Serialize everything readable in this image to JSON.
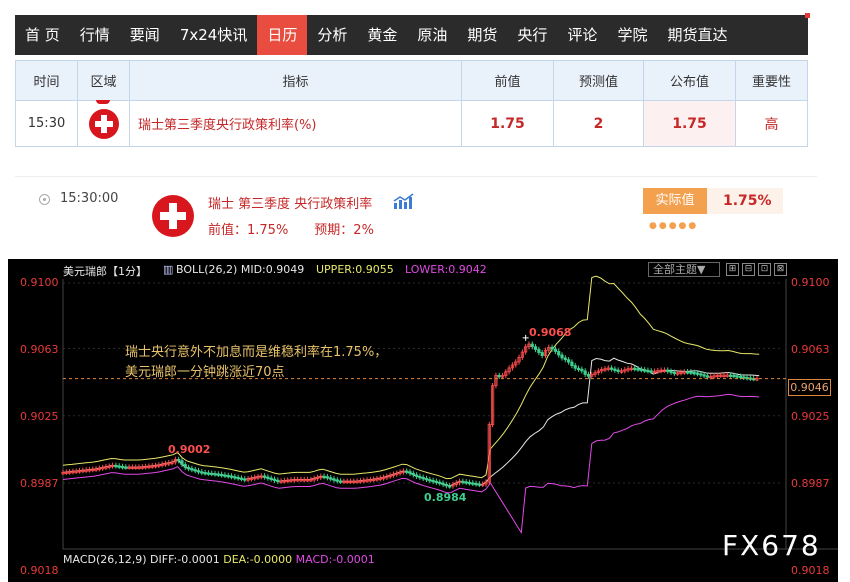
{
  "nav": {
    "items": [
      "首 页",
      "行情",
      "要闻",
      "7x24快讯",
      "日历",
      "分析",
      "黄金",
      "原油",
      "期货",
      "央行",
      "评论",
      "学院",
      "期货直达"
    ],
    "active_index": 4,
    "active_color": "#e94d3f"
  },
  "calendar": {
    "headers": {
      "time": "时间",
      "region": "区域",
      "indicator": "指标",
      "previous": "前值",
      "forecast": "预测值",
      "actual": "公布值",
      "importance": "重要性"
    },
    "row": {
      "time": "15:30",
      "flag": "swiss-flag-icon",
      "indicator": "瑞士第三季度央行政策利率(%)",
      "previous": "1.75",
      "forecast": "2",
      "actual": "1.75",
      "importance": "高"
    }
  },
  "event": {
    "time": "15:30:00",
    "title": "瑞士 第三季度 央行政策利率",
    "sub": "前值：1.75%　　预期：2%",
    "actual_label": "实际值",
    "actual_value": "1.75%",
    "stars": "●●●●●"
  },
  "chart_header": {
    "symbol": "美元瑞郎【1分】",
    "boll": "BOLL(26,2) MID:0.9049",
    "upper": "UPPER:0.9055",
    "lower": "LOWER:0.9042",
    "theme": "全部主题▼",
    "tools": [
      "⊞",
      "⊟",
      "⊡",
      "⊠"
    ]
  },
  "chart_data": {
    "type": "candlestick",
    "yticks": [
      "0.9100",
      "0.9063",
      "0.9025",
      "0.8987",
      "0.9018"
    ],
    "ylim": [
      0.8968,
      0.9106
    ],
    "current_price": "0.9046",
    "labels": {
      "high1": "0.9002",
      "low1": "0.8984",
      "high2": "0.9068"
    },
    "annotation": [
      "瑞士央行意外不加息而是维稳利率在1.75%，",
      "美元瑞郎一分钟跳涨近70点"
    ],
    "close_path": [
      [
        0,
        0.8993
      ],
      [
        15,
        0.8994
      ],
      [
        30,
        0.8995
      ],
      [
        45,
        0.8997
      ],
      [
        55,
        0.8996
      ],
      [
        70,
        0.8996
      ],
      [
        85,
        0.8997
      ],
      [
        100,
        0.8999
      ],
      [
        103,
        0.9001
      ],
      [
        110,
        0.8996
      ],
      [
        125,
        0.8993
      ],
      [
        140,
        0.8992
      ],
      [
        150,
        0.8991
      ],
      [
        165,
        0.8989
      ],
      [
        180,
        0.8991
      ],
      [
        195,
        0.8988
      ],
      [
        210,
        0.8989
      ],
      [
        225,
        0.8989
      ],
      [
        235,
        0.8991
      ],
      [
        250,
        0.8988
      ],
      [
        265,
        0.8988
      ],
      [
        280,
        0.8989
      ],
      [
        290,
        0.899
      ],
      [
        300,
        0.8992
      ],
      [
        310,
        0.8994
      ],
      [
        320,
        0.8991
      ],
      [
        330,
        0.8989
      ],
      [
        342,
        0.8987
      ],
      [
        350,
        0.8985
      ],
      [
        360,
        0.8988
      ],
      [
        370,
        0.8987
      ],
      [
        380,
        0.8986
      ],
      [
        385,
        0.8988
      ],
      [
        388,
        0.9036
      ],
      [
        392,
        0.9048
      ],
      [
        398,
        0.9047
      ],
      [
        405,
        0.9052
      ],
      [
        412,
        0.9056
      ],
      [
        418,
        0.9062
      ],
      [
        422,
        0.9066
      ],
      [
        428,
        0.9063
      ],
      [
        435,
        0.9059
      ],
      [
        440,
        0.9064
      ],
      [
        446,
        0.9062
      ],
      [
        452,
        0.9058
      ],
      [
        458,
        0.9056
      ],
      [
        464,
        0.9052
      ],
      [
        470,
        0.9051
      ],
      [
        476,
        0.9047
      ],
      [
        482,
        0.9049
      ],
      [
        488,
        0.9051
      ],
      [
        495,
        0.9052
      ],
      [
        505,
        0.905
      ],
      [
        515,
        0.9052
      ],
      [
        525,
        0.9051
      ],
      [
        535,
        0.905
      ],
      [
        545,
        0.9051
      ],
      [
        555,
        0.9049
      ],
      [
        565,
        0.905
      ],
      [
        575,
        0.9049
      ],
      [
        585,
        0.9047
      ],
      [
        595,
        0.9048
      ],
      [
        605,
        0.9048
      ],
      [
        615,
        0.9047
      ],
      [
        625,
        0.9046
      ],
      [
        632,
        0.9046
      ]
    ]
  },
  "macd": {
    "label": "MACD(26,12,9)",
    "diff": "DIFF:-0.0001",
    "dea": "DEA:-0.0000",
    "macd": "MACD:-0.0001"
  },
  "watermark": "FX678"
}
